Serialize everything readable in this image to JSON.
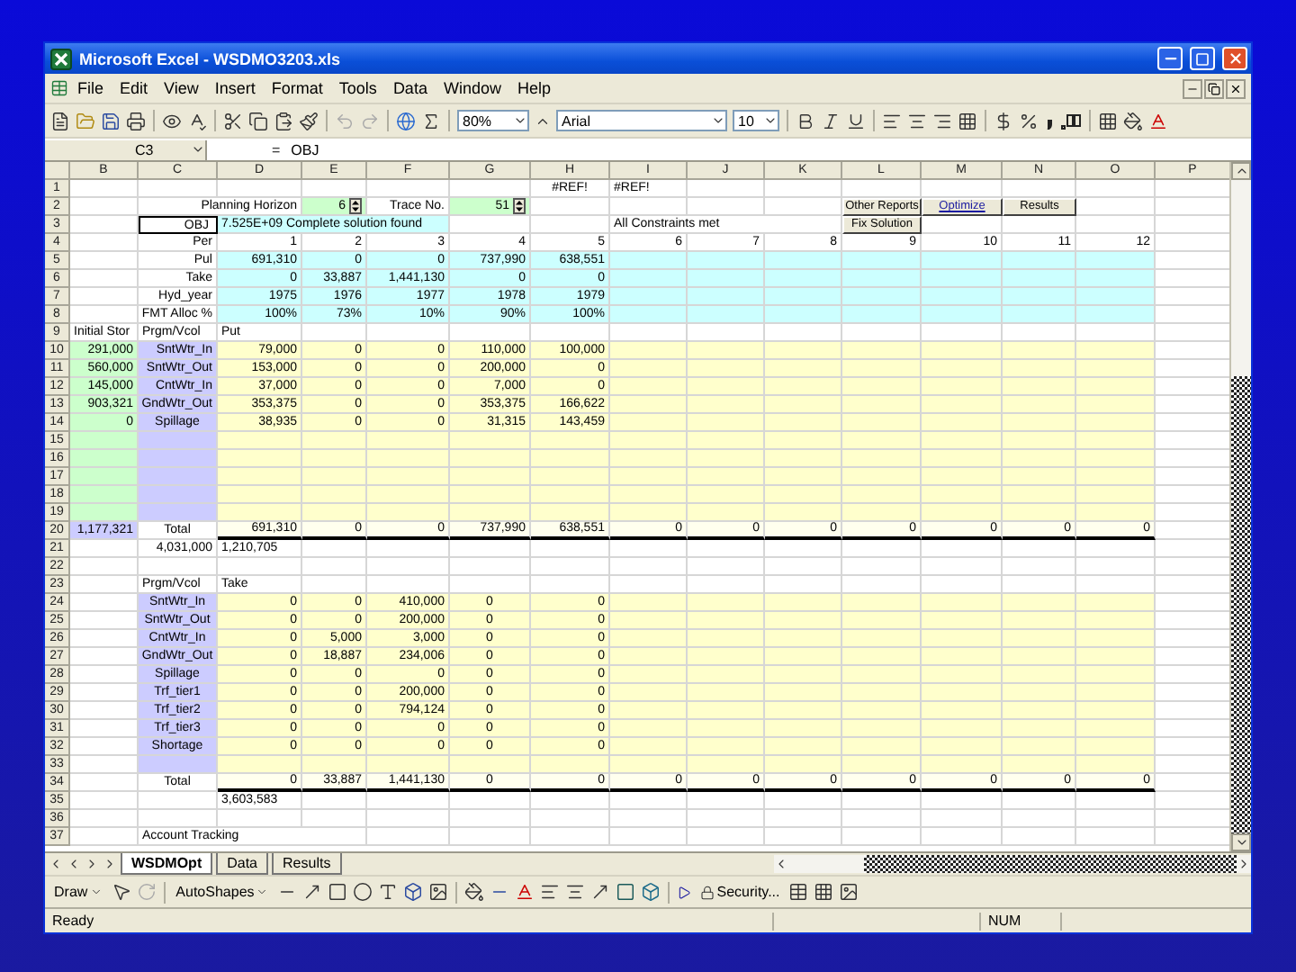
{
  "window": {
    "title": "Microsoft Excel - WSDMO3203.xls"
  },
  "menu": [
    "File",
    "Edit",
    "View",
    "Insert",
    "Format",
    "Tools",
    "Data",
    "Window",
    "Help"
  ],
  "toolbar": {
    "zoom": "80%",
    "font": "Arial",
    "size": "10"
  },
  "formula_bar": {
    "name_box": "C3",
    "equals": "=",
    "formula": "OBJ"
  },
  "sheet": {
    "columns": [
      "B",
      "C",
      "D",
      "E",
      "F",
      "G",
      "H",
      "I",
      "J",
      "K",
      "L",
      "M",
      "N",
      "O",
      "P"
    ],
    "rows": [
      {
        "number": "1",
        "kind": "plain",
        "cells": [
          {},
          {},
          {},
          {},
          {},
          {},
          {
            "text": "#REF!",
            "kind": "center"
          },
          {
            "text": "#REF!",
            "kind": "heading"
          }
        ]
      },
      {
        "number": "2",
        "kind": "plain",
        "cells": [
          {},
          {
            "text": "Planning Horizon",
            "kind": "caption"
          },
          {},
          {
            "text": "6",
            "kind": "spinner"
          },
          {
            "text": "Trace No."
          },
          {
            "text": "51",
            "kind": "spinner"
          },
          {},
          {},
          {},
          {},
          {
            "text": "Other Reports",
            "kind": "button"
          },
          {
            "text": "Optimize",
            "kind": "link"
          },
          {
            "text": "Results",
            "kind": "button"
          }
        ]
      },
      {
        "number": "3",
        "kind": "plain",
        "cells": [
          {},
          {
            "text": "OBJ",
            "selected": true
          },
          {
            "text": "7.525E+09 Complete solution found",
            "kind": "status"
          },
          {},
          {},
          {},
          {},
          {
            "text": "All Constraints met",
            "kind": "note"
          },
          {},
          {},
          {
            "text": "Fix Solution",
            "kind": "button"
          }
        ]
      },
      {
        "number": "4",
        "kind": "plain",
        "cells": [
          {},
          {
            "text": "Per"
          },
          {
            "text": "1"
          },
          {
            "text": "2"
          },
          {
            "text": "3"
          },
          {
            "text": "4"
          },
          {
            "text": "5"
          },
          {
            "text": "6"
          },
          {
            "text": "7"
          },
          {
            "text": "8"
          },
          {
            "text": "9"
          },
          {
            "text": "10"
          },
          {
            "text": "11"
          },
          {
            "text": "12"
          }
        ]
      },
      {
        "number": "5",
        "kind": "result",
        "cells": [
          {},
          {
            "text": "Pul"
          },
          {
            "text": "691,310"
          },
          {
            "text": "0"
          },
          {
            "text": "0"
          },
          {
            "text": "737,990"
          },
          {
            "text": "638,551"
          }
        ]
      },
      {
        "number": "6",
        "kind": "result",
        "cells": [
          {},
          {
            "text": "Take"
          },
          {
            "text": "0"
          },
          {
            "text": "33,887"
          },
          {
            "text": "1,441,130"
          },
          {
            "text": "0"
          },
          {
            "text": "0"
          }
        ]
      },
      {
        "number": "7",
        "kind": "result",
        "cells": [
          {},
          {
            "text": "Hyd_year"
          },
          {
            "text": "1975"
          },
          {
            "text": "1976"
          },
          {
            "text": "1977"
          },
          {
            "text": "1978"
          },
          {
            "text": "1979"
          }
        ]
      },
      {
        "number": "8",
        "kind": "result",
        "cells": [
          {},
          {
            "text": "FMT Alloc %"
          },
          {
            "text": "100%"
          },
          {
            "text": "73%"
          },
          {
            "text": "10%"
          },
          {
            "text": "90%"
          },
          {
            "text": "100%"
          }
        ]
      },
      {
        "number": "9",
        "kind": "plain",
        "cells": [
          {
            "text": "Initial Stor",
            "kind": "heading"
          },
          {
            "text": "Prgm/Vcol",
            "kind": "heading"
          },
          {
            "text": "Put",
            "kind": "heading"
          }
        ]
      },
      {
        "number": "10",
        "kind": "storage",
        "cells": [
          {
            "text": "291,000"
          },
          {
            "text": "SntWtr_In"
          },
          {
            "text": "79,000"
          },
          {
            "text": "0"
          },
          {
            "text": "0"
          },
          {
            "text": "110,000"
          },
          {
            "text": "100,000"
          }
        ]
      },
      {
        "number": "11",
        "kind": "storage",
        "cells": [
          {
            "text": "560,000"
          },
          {
            "text": "SntWtr_Out"
          },
          {
            "text": "153,000"
          },
          {
            "text": "0"
          },
          {
            "text": "0"
          },
          {
            "text": "200,000"
          },
          {
            "text": "0"
          }
        ]
      },
      {
        "number": "12",
        "kind": "storage",
        "cells": [
          {
            "text": "145,000"
          },
          {
            "text": "CntWtr_In"
          },
          {
            "text": "37,000"
          },
          {
            "text": "0"
          },
          {
            "text": "0"
          },
          {
            "text": "7,000"
          },
          {
            "text": "0"
          }
        ]
      },
      {
        "number": "13",
        "kind": "storage",
        "cells": [
          {
            "text": "903,321"
          },
          {
            "text": "GndWtr_Out"
          },
          {
            "text": "353,375"
          },
          {
            "text": "0"
          },
          {
            "text": "0"
          },
          {
            "text": "353,375"
          },
          {
            "text": "166,622"
          }
        ]
      },
      {
        "number": "14",
        "kind": "storage",
        "cells": [
          {
            "text": "0"
          },
          {
            "text": "Spillage",
            "kind": "center"
          },
          {
            "text": "38,935"
          },
          {
            "text": "0"
          },
          {
            "text": "0"
          },
          {
            "text": "31,315"
          },
          {
            "text": "143,459"
          }
        ]
      },
      {
        "number": "15",
        "kind": "storage"
      },
      {
        "number": "16",
        "kind": "storage"
      },
      {
        "number": "17",
        "kind": "storage"
      },
      {
        "number": "18",
        "kind": "storage"
      },
      {
        "number": "19",
        "kind": "storage"
      },
      {
        "number": "20",
        "kind": "storage_total",
        "cells": [
          {
            "text": "1,177,321"
          },
          {
            "text": "Total",
            "kind": "center"
          },
          {
            "text": "691,310"
          },
          {
            "text": "0"
          },
          {
            "text": "0"
          },
          {
            "text": "737,990"
          },
          {
            "text": "638,551"
          },
          {
            "text": "0"
          },
          {
            "text": "0"
          },
          {
            "text": "0"
          },
          {
            "text": "0"
          },
          {
            "text": "0"
          },
          {
            "text": "0"
          },
          {
            "text": "0"
          }
        ]
      },
      {
        "number": "21",
        "kind": "plain",
        "cells": [
          {},
          {
            "text": "4,031,000"
          },
          {
            "text": "1,210,705",
            "kind": "heading"
          }
        ]
      },
      {
        "number": "22",
        "kind": "plain"
      },
      {
        "number": "23",
        "kind": "plain",
        "cells": [
          {},
          {
            "text": "Prgm/Vcol",
            "kind": "heading"
          },
          {
            "text": "Take",
            "kind": "heading"
          }
        ]
      },
      {
        "number": "24",
        "kind": "schedule",
        "cells": [
          {},
          {
            "text": "SntWtr_In",
            "kind": "center"
          },
          {
            "text": "0"
          },
          {
            "text": "0"
          },
          {
            "text": "410,000"
          },
          {
            "text": "0",
            "kind": "center"
          },
          {
            "text": "0"
          }
        ]
      },
      {
        "number": "25",
        "kind": "schedule",
        "cells": [
          {},
          {
            "text": "SntWtr_Out",
            "kind": "center"
          },
          {
            "text": "0"
          },
          {
            "text": "0"
          },
          {
            "text": "200,000"
          },
          {
            "text": "0",
            "kind": "center"
          },
          {
            "text": "0"
          }
        ]
      },
      {
        "number": "26",
        "kind": "schedule",
        "cells": [
          {},
          {
            "text": "CntWtr_In",
            "kind": "center"
          },
          {
            "text": "0"
          },
          {
            "text": "5,000"
          },
          {
            "text": "3,000"
          },
          {
            "text": "0",
            "kind": "center"
          },
          {
            "text": "0"
          }
        ]
      },
      {
        "number": "27",
        "kind": "schedule",
        "cells": [
          {},
          {
            "text": "GndWtr_Out",
            "kind": "center"
          },
          {
            "text": "0"
          },
          {
            "text": "18,887"
          },
          {
            "text": "234,006"
          },
          {
            "text": "0",
            "kind": "center"
          },
          {
            "text": "0"
          }
        ]
      },
      {
        "number": "28",
        "kind": "schedule",
        "cells": [
          {},
          {
            "text": "Spillage",
            "kind": "center"
          },
          {
            "text": "0"
          },
          {
            "text": "0"
          },
          {
            "text": "0"
          },
          {
            "text": "0",
            "kind": "center"
          },
          {
            "text": "0"
          }
        ]
      },
      {
        "number": "29",
        "kind": "schedule",
        "cells": [
          {},
          {
            "text": "Trf_tier1",
            "kind": "center"
          },
          {
            "text": "0"
          },
          {
            "text": "0"
          },
          {
            "text": "200,000"
          },
          {
            "text": "0",
            "kind": "center"
          },
          {
            "text": "0"
          }
        ]
      },
      {
        "number": "30",
        "kind": "schedule",
        "cells": [
          {},
          {
            "text": "Trf_tier2",
            "kind": "center"
          },
          {
            "text": "0"
          },
          {
            "text": "0"
          },
          {
            "text": "794,124"
          },
          {
            "text": "0",
            "kind": "center"
          },
          {
            "text": "0"
          }
        ]
      },
      {
        "number": "31",
        "kind": "schedule",
        "cells": [
          {},
          {
            "text": "Trf_tier3",
            "kind": "center"
          },
          {
            "text": "0"
          },
          {
            "text": "0"
          },
          {
            "text": "0"
          },
          {
            "text": "0",
            "kind": "center"
          },
          {
            "text": "0"
          }
        ]
      },
      {
        "number": "32",
        "kind": "schedule",
        "cells": [
          {},
          {
            "text": "Shortage",
            "kind": "center"
          },
          {
            "text": "0"
          },
          {
            "text": "0"
          },
          {
            "text": "0"
          },
          {
            "text": "0",
            "kind": "center"
          },
          {
            "text": "0"
          }
        ]
      },
      {
        "number": "33",
        "kind": "schedule"
      },
      {
        "number": "34",
        "kind": "schedule_total",
        "cells": [
          {},
          {
            "text": "Total",
            "kind": "center"
          },
          {
            "text": "0"
          },
          {
            "text": "33,887"
          },
          {
            "text": "1,441,130"
          },
          {
            "text": "0",
            "kind": "center"
          },
          {
            "text": "0"
          },
          {
            "text": "0"
          },
          {
            "text": "0"
          },
          {
            "text": "0"
          },
          {
            "text": "0"
          },
          {
            "text": "0"
          },
          {
            "text": "0"
          },
          {
            "text": "0"
          }
        ]
      },
      {
        "number": "35",
        "kind": "plain",
        "cells": [
          {},
          {},
          {
            "text": "3,603,583",
            "kind": "heading"
          }
        ]
      },
      {
        "number": "36",
        "kind": "plain"
      },
      {
        "number": "37",
        "kind": "plain",
        "cells": [
          {},
          {
            "text": "Account Tracking",
            "kind": "note"
          }
        ]
      }
    ]
  },
  "sheet_tabs": [
    {
      "label": "WSDMOpt",
      "selected": true
    },
    {
      "label": "Data",
      "selected": false
    },
    {
      "label": "Results",
      "selected": false
    }
  ],
  "drawing_toolbar": {
    "draw": "Draw",
    "autoshapes": "AutoShapes",
    "security": "Security..."
  },
  "status_bar": {
    "status": "Ready",
    "num": "NUM"
  }
}
